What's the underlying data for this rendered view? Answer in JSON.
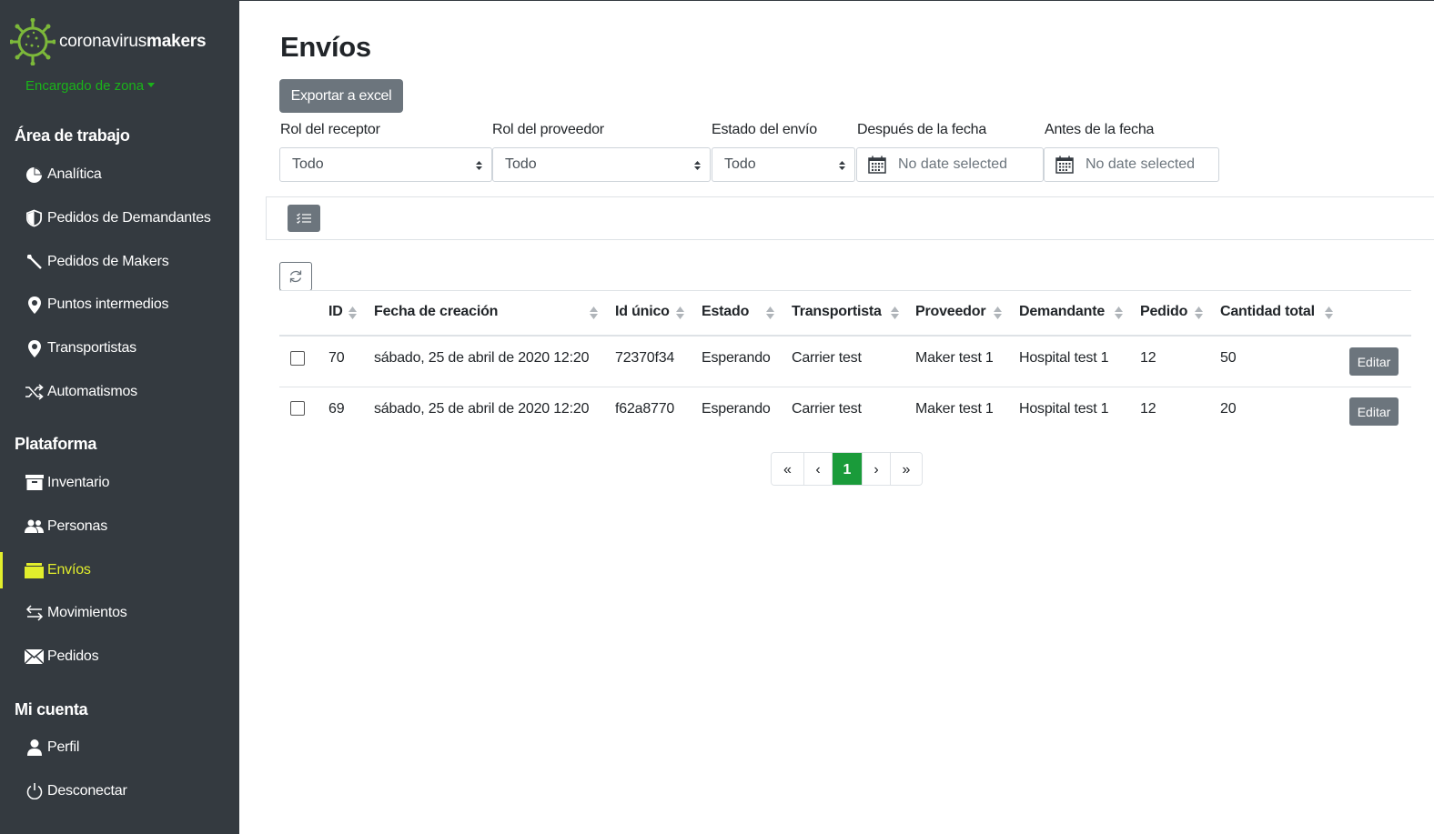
{
  "brand": {
    "name_light": "coronavirus",
    "name_bold": "makers",
    "role": "Encargado de zona"
  },
  "sidebar": {
    "sections": [
      {
        "title": "Área de trabajo",
        "items": [
          {
            "label": "Analítica",
            "icon": "pie-chart-icon"
          },
          {
            "label": "Pedidos de Demandantes",
            "icon": "heart-shield-icon"
          },
          {
            "label": "Pedidos de Makers",
            "icon": "wrench-icon"
          },
          {
            "label": "Puntos intermedios",
            "icon": "map-pin-icon"
          },
          {
            "label": "Transportistas",
            "icon": "map-pin-icon"
          },
          {
            "label": "Automatismos",
            "icon": "shuffle-icon"
          }
        ]
      },
      {
        "title": "Plataforma",
        "items": [
          {
            "label": "Inventario",
            "icon": "archive-icon"
          },
          {
            "label": "Personas",
            "icon": "people-icon"
          },
          {
            "label": "Envíos",
            "icon": "box-icon",
            "active": true
          },
          {
            "label": "Movimientos",
            "icon": "arrows-exchange-icon"
          },
          {
            "label": "Pedidos",
            "icon": "envelope-icon"
          }
        ]
      },
      {
        "title": "Mi cuenta",
        "items": [
          {
            "label": "Perfil",
            "icon": "person-icon"
          },
          {
            "label": "Desconectar",
            "icon": "power-icon"
          }
        ]
      }
    ],
    "active_color": "#e2ee2c"
  },
  "page": {
    "title": "Envíos",
    "export_label": "Exportar a excel"
  },
  "filters": {
    "receptor": {
      "label": "Rol del receptor",
      "value": "Todo"
    },
    "proveedor": {
      "label": "Rol del proveedor",
      "value": "Todo"
    },
    "estado": {
      "label": "Estado del envío",
      "value": "Todo"
    },
    "despues": {
      "label": "Después de la fecha",
      "placeholder": "No date selected"
    },
    "antes": {
      "label": "Antes de la fecha",
      "placeholder": "No date selected"
    }
  },
  "table": {
    "headers": [
      "ID",
      "Fecha de creación",
      "Id único",
      "Estado",
      "Transportista",
      "Proveedor",
      "Demandante",
      "Pedido",
      "Cantidad total"
    ],
    "rows": [
      {
        "id": "70",
        "fecha": "sábado, 25 de abril de 2020 12:20",
        "uid": "72370f34",
        "estado": "Esperando",
        "transportista": "Carrier test",
        "proveedor": "Maker test 1",
        "demandante": "Hospital test 1",
        "pedido": "12",
        "cantidad": "50",
        "action": "Editar"
      },
      {
        "id": "69",
        "fecha": "sábado, 25 de abril de 2020 12:20",
        "uid": "f62a8770",
        "estado": "Esperando",
        "transportista": "Carrier test",
        "proveedor": "Maker test 1",
        "demandante": "Hospital test 1",
        "pedido": "12",
        "cantidad": "20",
        "action": "Editar"
      }
    ]
  },
  "pagination": {
    "first": "«",
    "prev": "‹",
    "current": "1",
    "next": "›",
    "last": "»",
    "current_color": "#1a9b3a"
  }
}
